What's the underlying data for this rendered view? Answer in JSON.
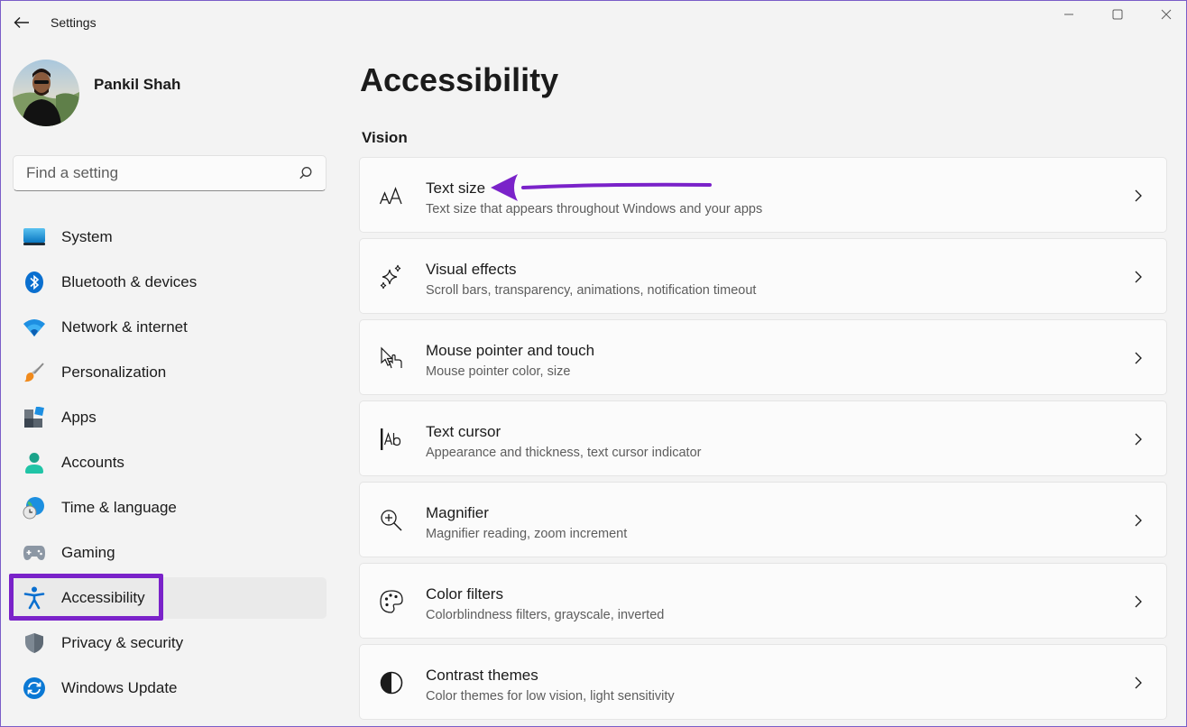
{
  "window": {
    "title": "Settings"
  },
  "profile": {
    "name": "Pankil Shah"
  },
  "search": {
    "placeholder": "Find a setting"
  },
  "sidebar": {
    "items": [
      {
        "label": "System",
        "icon": "system-icon"
      },
      {
        "label": "Bluetooth & devices",
        "icon": "bluetooth-icon"
      },
      {
        "label": "Network & internet",
        "icon": "wifi-icon"
      },
      {
        "label": "Personalization",
        "icon": "brush-icon"
      },
      {
        "label": "Apps",
        "icon": "apps-icon"
      },
      {
        "label": "Accounts",
        "icon": "person-icon"
      },
      {
        "label": "Time & language",
        "icon": "globe-clock-icon"
      },
      {
        "label": "Gaming",
        "icon": "gamepad-icon"
      },
      {
        "label": "Accessibility",
        "icon": "accessibility-icon",
        "active": true
      },
      {
        "label": "Privacy & security",
        "icon": "shield-icon"
      },
      {
        "label": "Windows Update",
        "icon": "update-icon"
      }
    ]
  },
  "main": {
    "title": "Accessibility",
    "section": "Vision",
    "cards": [
      {
        "title": "Text size",
        "subtitle": "Text size that appears throughout Windows and your apps",
        "icon": "text-size-icon"
      },
      {
        "title": "Visual effects",
        "subtitle": "Scroll bars, transparency, animations, notification timeout",
        "icon": "sparkle-icon"
      },
      {
        "title": "Mouse pointer and touch",
        "subtitle": "Mouse pointer color, size",
        "icon": "pointer-touch-icon"
      },
      {
        "title": "Text cursor",
        "subtitle": "Appearance and thickness, text cursor indicator",
        "icon": "text-cursor-icon"
      },
      {
        "title": "Magnifier",
        "subtitle": "Magnifier reading, zoom increment",
        "icon": "magnifier-icon"
      },
      {
        "title": "Color filters",
        "subtitle": "Colorblindness filters, grayscale, inverted",
        "icon": "palette-icon"
      },
      {
        "title": "Contrast themes",
        "subtitle": "Color themes for low vision, light sensitivity",
        "icon": "contrast-icon"
      }
    ]
  },
  "colors": {
    "accent": "#0067c0",
    "annotation": "#7a22c9",
    "background": "#f3f3f3",
    "card": "#fbfbfb"
  }
}
